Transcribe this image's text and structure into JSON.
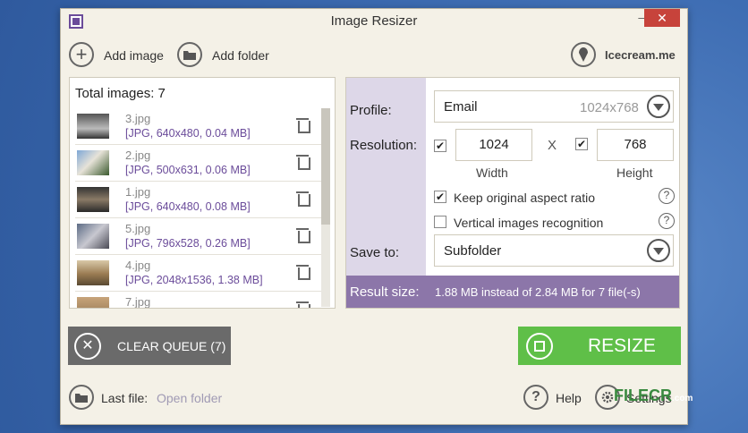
{
  "window": {
    "title": "Image Resizer",
    "minimize_label": "–",
    "close_label": "✕"
  },
  "toolbar": {
    "add_image_label": "Add image",
    "add_folder_label": "Add folder",
    "brand_label": "Icecream.me"
  },
  "queue": {
    "total_label": "Total images: 7",
    "items": [
      {
        "name": "3.jpg",
        "info": "[JPG, 640x480, 0.04 MB]"
      },
      {
        "name": "2.jpg",
        "info": "[JPG, 500x631, 0.06 MB]"
      },
      {
        "name": "1.jpg",
        "info": "[JPG, 640x480, 0.08 MB]"
      },
      {
        "name": "5.jpg",
        "info": "[JPG, 796x528, 0.26 MB]"
      },
      {
        "name": "4.jpg",
        "info": "[JPG, 2048x1536, 1.38 MB]"
      },
      {
        "name": "7.jpg",
        "info": ""
      }
    ]
  },
  "settings": {
    "profile_label": "Profile:",
    "profile_value": "Email",
    "profile_dims": "1024x768",
    "resolution_label": "Resolution:",
    "width_value": "1024",
    "height_value": "768",
    "x_label": "X",
    "width_caption": "Width",
    "height_caption": "Height",
    "keep_aspect_label": "Keep original aspect ratio",
    "keep_aspect_checked": "✔",
    "vertical_recog_label": "Vertical images recognition",
    "width_checked": "✔",
    "height_checked": "✔",
    "save_to_label": "Save to:",
    "save_to_value": "Subfolder",
    "help_symbol": "?"
  },
  "result": {
    "label": "Result size:",
    "value": "1.88 MB instead of 2.84 MB for 7 file(-s)"
  },
  "actions": {
    "clear_label": "CLEAR QUEUE (7)",
    "resize_label": "RESIZE"
  },
  "footer": {
    "last_file_label": "Last file:",
    "open_folder_label": "Open folder",
    "help_label": "Help",
    "settings_label": "Settings",
    "help_symbol": "?"
  },
  "watermark": {
    "text": "FILECR",
    "suffix": ".com"
  },
  "colors": {
    "accent_purple": "#6b4c9a",
    "result_bar": "#8c76a9",
    "resize_green": "#5fbf48",
    "clear_gray": "#6a6a6a",
    "close_red": "#c7433b"
  }
}
